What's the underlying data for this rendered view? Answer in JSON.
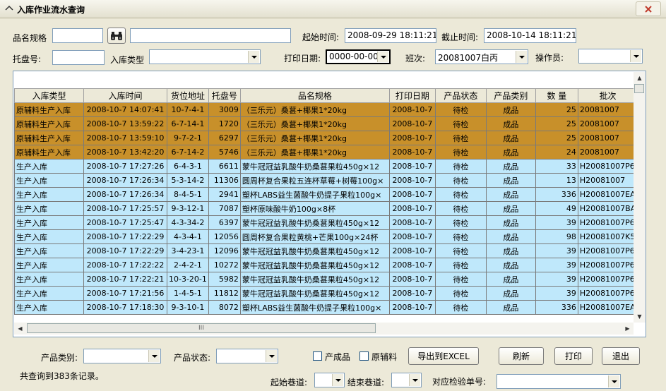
{
  "window": {
    "title": "入库作业流水查询"
  },
  "filters": {
    "product_spec_label": "品名规格",
    "product_spec_code": "",
    "product_spec_name": "",
    "start_time_label": "起始时间:",
    "start_time_value": "2008-09-29 18:11:21",
    "end_time_label": "截止时间:",
    "end_time_value": "2008-10-14 18:11:21",
    "pallet_label": "托盘号:",
    "pallet_value": "",
    "inbound_type_label": "入库类型",
    "inbound_type_value": "",
    "print_date_label": "打印日期:",
    "print_date_value": "0000-00-00",
    "shift_label": "班次:",
    "shift_value": "20081007白丙",
    "operator_label": "操作员:",
    "operator_value": ""
  },
  "table": {
    "columns": [
      "入库类型",
      "入库时间",
      "货位地址",
      "托盘号",
      "品名规格",
      "打印日期",
      "产品状态",
      "产品类别",
      "数 量",
      "批次"
    ],
    "rows": [
      {
        "style": "orange",
        "cells": [
          "原辅料生产入库",
          "2008-10-7 14:07:41",
          "10-7-4-1",
          "3009",
          "（三乐元）桑葚+椰果1*20kg",
          "2008-10-7",
          "待检",
          "成品",
          "25",
          "20081007"
        ]
      },
      {
        "style": "orange",
        "cells": [
          "原辅料生产入库",
          "2008-10-7 13:59:22",
          "6-7-14-1",
          "1720",
          "（三乐元）桑葚+椰果1*20kg",
          "2008-10-7",
          "待检",
          "成品",
          "25",
          "20081007"
        ]
      },
      {
        "style": "orange",
        "cells": [
          "原辅料生产入库",
          "2008-10-7 13:59:10",
          "9-7-2-1",
          "6297",
          "（三乐元）桑葚+椰果1*20kg",
          "2008-10-7",
          "待检",
          "成品",
          "25",
          "20081007"
        ]
      },
      {
        "style": "orange",
        "cells": [
          "原辅料生产入库",
          "2008-10-7 13:42:20",
          "6-7-14-2",
          "5746",
          "（三乐元）桑葚+椰果1*20kg",
          "2008-10-7",
          "待检",
          "成品",
          "24",
          "20081007"
        ]
      },
      {
        "style": "blue",
        "cells": [
          "生产入库",
          "2008-10-7 17:27:26",
          "6-4-3-1",
          "6611",
          "蒙牛冠冠益乳酸牛奶桑葚果粒450g×12",
          "2008-10-7",
          "待检",
          "成品",
          "33",
          "H20081007P6"
        ]
      },
      {
        "style": "blue",
        "cells": [
          "生产入库",
          "2008-10-7 17:26:34",
          "5-3-14-2",
          "11306",
          "圆周杯复合果粒五连杯草莓+树莓100g×",
          "2008-10-7",
          "待检",
          "成品",
          "13",
          "H20081007"
        ]
      },
      {
        "style": "blue",
        "cells": [
          "生产入库",
          "2008-10-7 17:26:34",
          "8-4-5-1",
          "2941",
          "塑杯LABS益生菌酸牛奶提子果粒100g×",
          "2008-10-7",
          "待检",
          "成品",
          "336",
          "H20081007EA"
        ]
      },
      {
        "style": "blue",
        "cells": [
          "生产入库",
          "2008-10-7 17:25:57",
          "9-3-12-1",
          "7087",
          "塑杯原味酸牛奶100g×8杯",
          "2008-10-7",
          "待检",
          "成品",
          "49",
          "H20081007BA"
        ]
      },
      {
        "style": "blue",
        "cells": [
          "生产入库",
          "2008-10-7 17:25:47",
          "4-3-34-2",
          "6397",
          "蒙牛冠冠益乳酸牛奶桑葚果粒450g×12",
          "2008-10-7",
          "待检",
          "成品",
          "39",
          "H20081007P6"
        ]
      },
      {
        "style": "blue",
        "cells": [
          "生产入库",
          "2008-10-7 17:22:29",
          "4-3-4-1",
          "12056",
          "圆周杯复合果粒黄桃+芒果100g×24杯",
          "2008-10-7",
          "待检",
          "成品",
          "98",
          "H20081007K5"
        ]
      },
      {
        "style": "blue",
        "cells": [
          "生产入库",
          "2008-10-7 17:22:29",
          "3-4-23-1",
          "12096",
          "蒙牛冠冠益乳酸牛奶桑葚果粒450g×12",
          "2008-10-7",
          "待检",
          "成品",
          "39",
          "H20081007P6"
        ]
      },
      {
        "style": "blue",
        "cells": [
          "生产入库",
          "2008-10-7 17:22:22",
          "2-4-2-1",
          "10272",
          "蒙牛冠冠益乳酸牛奶桑葚果粒450g×12",
          "2008-10-7",
          "待检",
          "成品",
          "39",
          "H20081007P6"
        ]
      },
      {
        "style": "blue",
        "cells": [
          "生产入库",
          "2008-10-7 17:22:21",
          "10-3-20-1",
          "5982",
          "蒙牛冠冠益乳酸牛奶桑葚果粒450g×12",
          "2008-10-7",
          "待检",
          "成品",
          "39",
          "H20081007P6"
        ]
      },
      {
        "style": "blue",
        "cells": [
          "生产入库",
          "2008-10-7 17:21:56",
          "1-4-5-1",
          "11812",
          "蒙牛冠冠益乳酸牛奶桑葚果粒450g×12",
          "2008-10-7",
          "待检",
          "成品",
          "39",
          "H20081007P6"
        ]
      },
      {
        "style": "blue",
        "cells": [
          "生产入库",
          "2008-10-7 17:18:30",
          "9-3-10-1",
          "8072",
          "塑杯LABS益生菌酸牛奶提子果粒100g×",
          "2008-10-7",
          "待检",
          "成品",
          "336",
          "H20081007EA"
        ]
      }
    ]
  },
  "hscroll_grip": "III",
  "bottom": {
    "product_category_label": "产品类别:",
    "product_category_value": "",
    "product_status_label": "产品状态:",
    "product_status_value": "",
    "finished_label": "产成品",
    "raw_label": "原辅料",
    "export_label": "导出到EXCEL",
    "refresh_label": "刷新",
    "print_label": "打印",
    "exit_label": "退出",
    "record_count": "共查询到383条记录。",
    "start_lane_label": "起始巷道:",
    "start_lane_value": "",
    "end_lane_label": "结束巷道:",
    "end_lane_value": "",
    "inspection_label": "对应检验单号:",
    "inspection_value": ""
  }
}
